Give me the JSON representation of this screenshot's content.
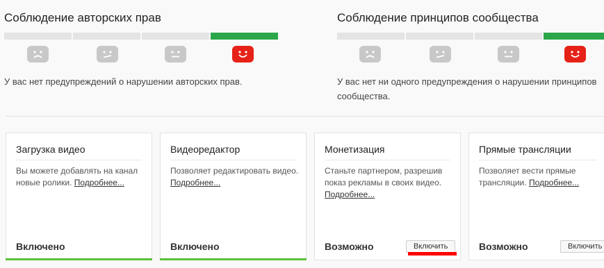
{
  "copyright": {
    "title": "Соблюдение авторских прав",
    "description": "У вас нет предупреждений о нарушении авторских прав.",
    "faces": [
      "sad-face-icon",
      "confused-face-icon",
      "neutral-face-icon",
      "happy-face-icon"
    ],
    "active_level": 4
  },
  "community": {
    "title": "Соблюдение принципов сообщества",
    "description_line1": "У вас нет ни одного предупреждения о нарушении принципов",
    "description_line2": "сообщества.",
    "faces": [
      "sad-face-icon",
      "confused-face-icon",
      "neutral-face-icon",
      "happy-face-icon"
    ],
    "active_level": 4
  },
  "features": [
    {
      "title": "Загрузка видео",
      "description": "Вы можете добавлять на канал новые ролики.",
      "more_link": "Подробнее...",
      "status": "Включено",
      "enabled": true
    },
    {
      "title": "Видеоредактор",
      "description": "Позволяет редактировать видео.",
      "more_link": "Подробнее...",
      "status": "Включено",
      "enabled": true
    },
    {
      "title": "Монетизация",
      "description": "Станьте партнером, разрешив показ рекламы в своих видео.",
      "more_link": "Подробнее...",
      "status": "Возможно",
      "button_label": "Включить",
      "enabled": false
    },
    {
      "title": "Прямые трансляции",
      "description": "Позволяет вести прямые трансляции.",
      "more_link": "Подробнее...",
      "status": "Возможно",
      "button_label": "Включить",
      "enabled": false
    }
  ],
  "colors": {
    "active_green": "#2ba64a",
    "enabled_bar": "#5cc13a",
    "happy_red": "#e62117",
    "highlight": "#ff0000"
  }
}
